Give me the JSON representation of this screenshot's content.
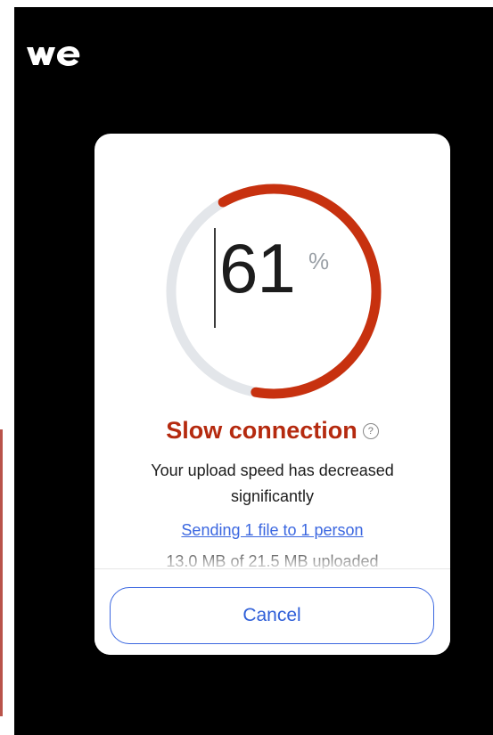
{
  "progress": {
    "percent": 61,
    "value_text": "61",
    "unit": "%"
  },
  "status": {
    "title": "Slow connection",
    "help_symbol": "?",
    "description": "Your upload speed has decreased significantly"
  },
  "transfer": {
    "link_text": "Sending 1 file to 1 person",
    "uploaded_text": "13.0 MB of 21.5 MB uploaded"
  },
  "actions": {
    "cancel_label": "Cancel"
  },
  "colors": {
    "progress": "#c7310f",
    "track": "#e3e6ea",
    "accent": "#3b67e0",
    "status": "#b52a0f"
  },
  "icons": {
    "logo": "wetransfer-logo",
    "help": "help-circle-icon"
  }
}
